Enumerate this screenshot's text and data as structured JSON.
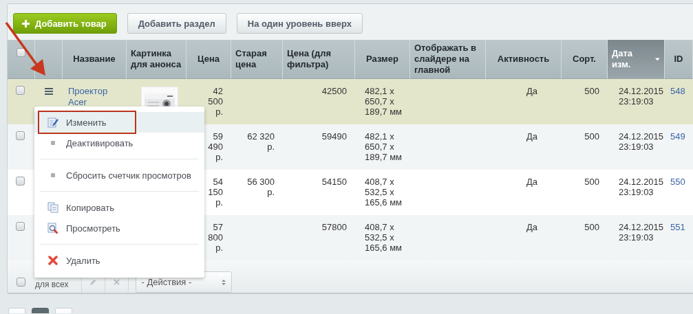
{
  "toolbar": {
    "buttons": [
      {
        "label": "Добавить товар",
        "kind": "primary"
      },
      {
        "label": "Добавить раздел",
        "kind": "default"
      },
      {
        "label": "На один уровень вверх",
        "kind": "default"
      }
    ]
  },
  "table": {
    "select_all": {
      "checked": false
    },
    "columns": [
      {
        "label": "Название",
        "sorted": false
      },
      {
        "label": "Картинка для анонса",
        "sorted": false
      },
      {
        "label": "Цена",
        "sorted": false
      },
      {
        "label": "Старая цена",
        "sorted": false
      },
      {
        "label": "Цена (для фильтра)",
        "sorted": false
      },
      {
        "label": "Размер",
        "sorted": false
      },
      {
        "label": "Отображать в слайдере на главной",
        "sorted": false
      },
      {
        "label": "Активность",
        "sorted": false
      },
      {
        "label": "Сорт.",
        "sorted": false
      },
      {
        "label": "Дата изм.",
        "sorted": true
      },
      {
        "label": "ID",
        "sorted": false
      }
    ],
    "rows": [
      {
        "checked": false,
        "highlighted": true,
        "actions_button": true,
        "name": "Проектор Acer",
        "price": "42 500 р.",
        "filter_price": "42500",
        "size": "482,1 x 650,7 x 189,7 мм",
        "active": "Да",
        "sort": "500",
        "modified": "24.12.2015 23:19:03",
        "id": "548"
      },
      {
        "checked": false,
        "highlighted": false,
        "price": "59 490 р.",
        "old_price": "62 320 р.",
        "filter_price": "59490",
        "size": "482,1 x 650,7 x 189,7 мм",
        "active": "Да",
        "sort": "500",
        "modified": "24.12.2015 23:19:03",
        "id": "549"
      },
      {
        "checked": false,
        "highlighted": false,
        "price": "54 150 р.",
        "old_price": "56 300 р.",
        "filter_price": "54150",
        "size": "408,7 x 532,5 x 165,6 мм",
        "active": "Да",
        "sort": "500",
        "modified": "24.12.2015 23:19:03",
        "id": "550"
      },
      {
        "checked": false,
        "highlighted": false,
        "price": "57 800 р.",
        "filter_price": "57800",
        "size": "408,7 x 532,5 x 165,6 мм",
        "active": "Да",
        "sort": "500",
        "modified": "24.12.2015 23:19:03",
        "id": "551"
      }
    ],
    "footer": {
      "checked": false,
      "label": "для всех",
      "actions_select": "- Действия -"
    }
  },
  "context_menu": {
    "groups": [
      [
        {
          "label": "Изменить",
          "kind": "edit",
          "selected": true
        },
        {
          "label": "Деактивировать",
          "kind": "dot",
          "selected": false
        }
      ],
      [
        {
          "label": "Сбросить счетчик просмотров",
          "kind": "dot",
          "selected": false
        }
      ],
      [
        {
          "label": "Копировать",
          "kind": "copy",
          "selected": false
        },
        {
          "label": "Просмотреть",
          "kind": "view",
          "selected": false
        }
      ],
      [
        {
          "label": "Удалить",
          "kind": "delete",
          "selected": false
        }
      ]
    ]
  },
  "pagination": {
    "pages": [
      {
        "selected": false
      },
      {
        "selected": true
      },
      {
        "selected": false
      }
    ]
  }
}
